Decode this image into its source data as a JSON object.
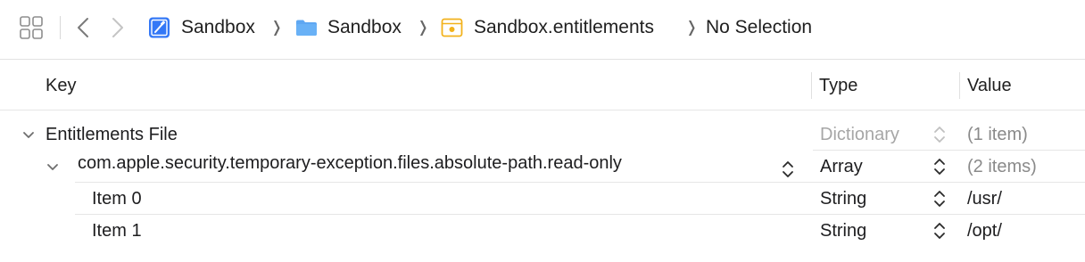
{
  "toolbar": {
    "grid_icon": "grid-icon",
    "back_icon": "chevron-left-icon",
    "forward_icon": "chevron-right-icon"
  },
  "breadcrumb": {
    "separator": "❭",
    "items": [
      {
        "label": "Sandbox",
        "icon": "xcode-project-icon"
      },
      {
        "label": "Sandbox",
        "icon": "folder-icon"
      },
      {
        "label": "Sandbox.entitlements",
        "icon": "entitlements-file-icon"
      },
      {
        "label": "No Selection"
      }
    ]
  },
  "columns": {
    "key": "Key",
    "type": "Type",
    "value": "Value"
  },
  "rows": [
    {
      "key": "Entitlements File",
      "type": "Dictionary",
      "value": "(1 item)",
      "expanded": true
    },
    {
      "key": "com.apple.security.temporary-exception.files.absolute-path.read-only",
      "type": "Array",
      "value": "(2 items)",
      "expanded": true
    },
    {
      "key": "Item 0",
      "type": "String",
      "value": "/usr/"
    },
    {
      "key": "Item 1",
      "type": "String",
      "value": "/opt/"
    }
  ],
  "colors": {
    "accent_blue": "#3478f6",
    "folder_blue": "#5ea7f2",
    "entitlements_yellow": "#f2b21c"
  }
}
